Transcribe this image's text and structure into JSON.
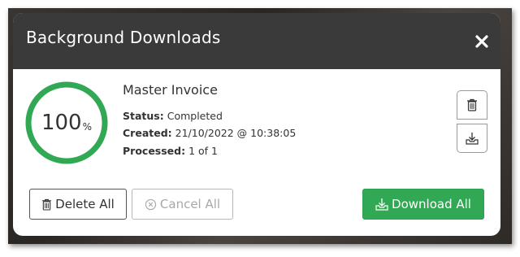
{
  "modal": {
    "title": "Background Downloads"
  },
  "job": {
    "progress_percent": 100,
    "progress_value": "100",
    "progress_unit": "%",
    "name": "Master Invoice",
    "status_label": "Status:",
    "status_value": "Completed",
    "created_label": "Created:",
    "created_value": "21/10/2022 @ 10:38:05",
    "processed_label": "Processed:",
    "processed_value": "1 of 1"
  },
  "actions": {
    "delete_all": "Delete All",
    "cancel_all": "Cancel All",
    "download_all": "Download All"
  },
  "colors": {
    "header_bg": "#3a3a3a",
    "progress_ring": "#31a853",
    "download_button": "#31a853"
  },
  "icons": [
    "close-icon",
    "trash-icon",
    "download-tray-icon",
    "cancel-circle-icon"
  ]
}
